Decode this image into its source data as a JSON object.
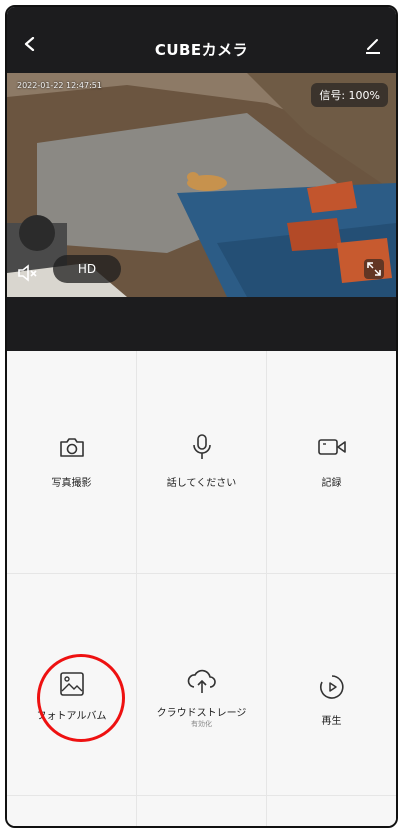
{
  "header": {
    "title": "CUBEカメラ"
  },
  "video": {
    "timestamp": "2022-01-22 12:47:51",
    "signal": "信号: 100%",
    "quality": "HD"
  },
  "controls": [
    {
      "label": "写真撮影",
      "icon": "camera-icon"
    },
    {
      "label": "話してください",
      "icon": "microphone-icon"
    },
    {
      "label": "記録",
      "icon": "video-camera-icon"
    },
    {
      "label": "フォトアルバム",
      "icon": "photo-album-icon"
    },
    {
      "label": "クラウドストレージ",
      "sublabel": "有効化",
      "icon": "cloud-upload-icon"
    },
    {
      "label": "再生",
      "icon": "play-icon"
    }
  ],
  "colors": {
    "header_bg": "#1c1c1e",
    "highlight": "#e11111"
  }
}
